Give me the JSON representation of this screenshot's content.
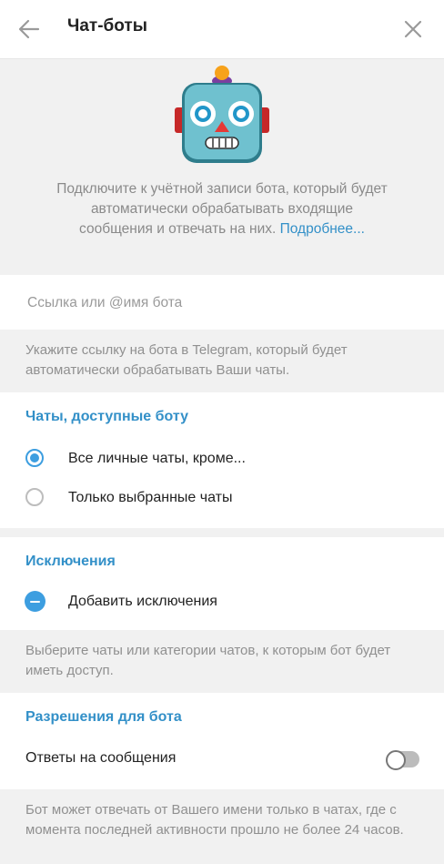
{
  "header": {
    "title": "Чат-боты",
    "back_icon": "arrow-left-icon",
    "close_icon": "close-icon"
  },
  "hero": {
    "icon": "robot-face-icon",
    "text": "Подключите к учётной записи бота, который будет автоматически обрабатывать входящие сообщения и отвечать на них.",
    "link": "Подробнее..."
  },
  "bot_input": {
    "placeholder": "Ссылка или @имя бота",
    "value": ""
  },
  "bot_input_note": "Укажите ссылку на бота в Telegram, который будет автоматически обрабатывать Ваши чаты.",
  "chats_section": {
    "title": "Чаты, доступные боту",
    "options": [
      {
        "label": "Все личные чаты, кроме...",
        "selected": true
      },
      {
        "label": "Только выбранные чаты",
        "selected": false
      }
    ]
  },
  "exceptions_section": {
    "title": "Исключения",
    "add_label": "Добавить исключения",
    "note": "Выберите чаты или категории чатов, к которым бот будет иметь доступ."
  },
  "permissions_section": {
    "title": "Разрешения для бота",
    "reply_label": "Ответы на сообщения",
    "reply_enabled": false,
    "note": "Бот может отвечать от Вашего имени только в чатах, где с момента последней активности прошло не более 24 часов."
  },
  "colors": {
    "accent": "#3390c8",
    "radio": "#3d9ee0"
  }
}
